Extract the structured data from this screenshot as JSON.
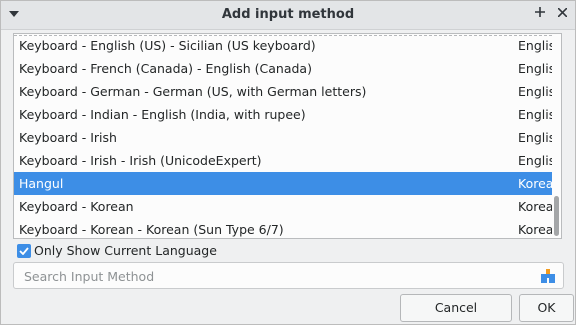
{
  "window": {
    "title": "Add input method"
  },
  "list": {
    "items": [
      {
        "name": "Keyboard - English (US) - Sicilian (US keyboard)",
        "lang": "English"
      },
      {
        "name": "Keyboard - French (Canada) - English (Canada)",
        "lang": "English"
      },
      {
        "name": "Keyboard - German - German (US, with German letters)",
        "lang": "English"
      },
      {
        "name": "Keyboard - Indian - English (India, with rupee)",
        "lang": "English"
      },
      {
        "name": "Keyboard - Irish",
        "lang": "English"
      },
      {
        "name": "Keyboard - Irish - Irish (UnicodeExpert)",
        "lang": "English"
      },
      {
        "name": "Hangul",
        "lang": "Korean"
      },
      {
        "name": "Keyboard - Korean",
        "lang": "Korean"
      },
      {
        "name": "Keyboard - Korean - Korean (Sun Type 6/7)",
        "lang": "Korean"
      }
    ],
    "selected_item": "Hangul"
  },
  "filter": {
    "only_current_label": "Only Show Current Language",
    "only_current_checked": true
  },
  "search": {
    "placeholder": "Search Input Method"
  },
  "buttons": {
    "cancel": "Cancel",
    "ok": "OK"
  },
  "colors": {
    "selection": "#3d8ee6",
    "background": "#eff0f1"
  }
}
